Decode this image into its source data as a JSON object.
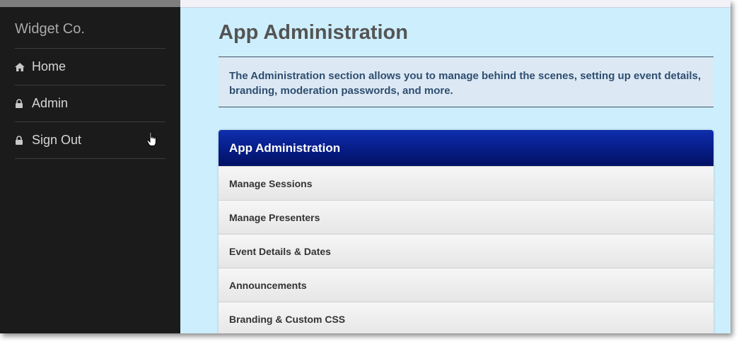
{
  "sidebar": {
    "brand": "Widget Co.",
    "items": [
      {
        "label": "Home",
        "icon": "home-icon"
      },
      {
        "label": "Admin",
        "icon": "lock-icon"
      },
      {
        "label": "Sign Out",
        "icon": "lock-icon"
      }
    ]
  },
  "main": {
    "title": "App Administration",
    "intro": "The Administration section allows you to manage behind the scenes, setting up event details, branding, moderation passwords, and more.",
    "panel": {
      "header": "App Administration",
      "items": [
        {
          "label": "Manage Sessions"
        },
        {
          "label": "Manage Presenters"
        },
        {
          "label": "Event Details & Dates"
        },
        {
          "label": "Announcements"
        },
        {
          "label": "Branding & Custom CSS"
        }
      ]
    }
  },
  "colors": {
    "sidebar_bg": "#1b1b1b",
    "main_bg": "#cdeefd",
    "panel_header": "#061c86",
    "intro_text": "#2f4e6f"
  }
}
